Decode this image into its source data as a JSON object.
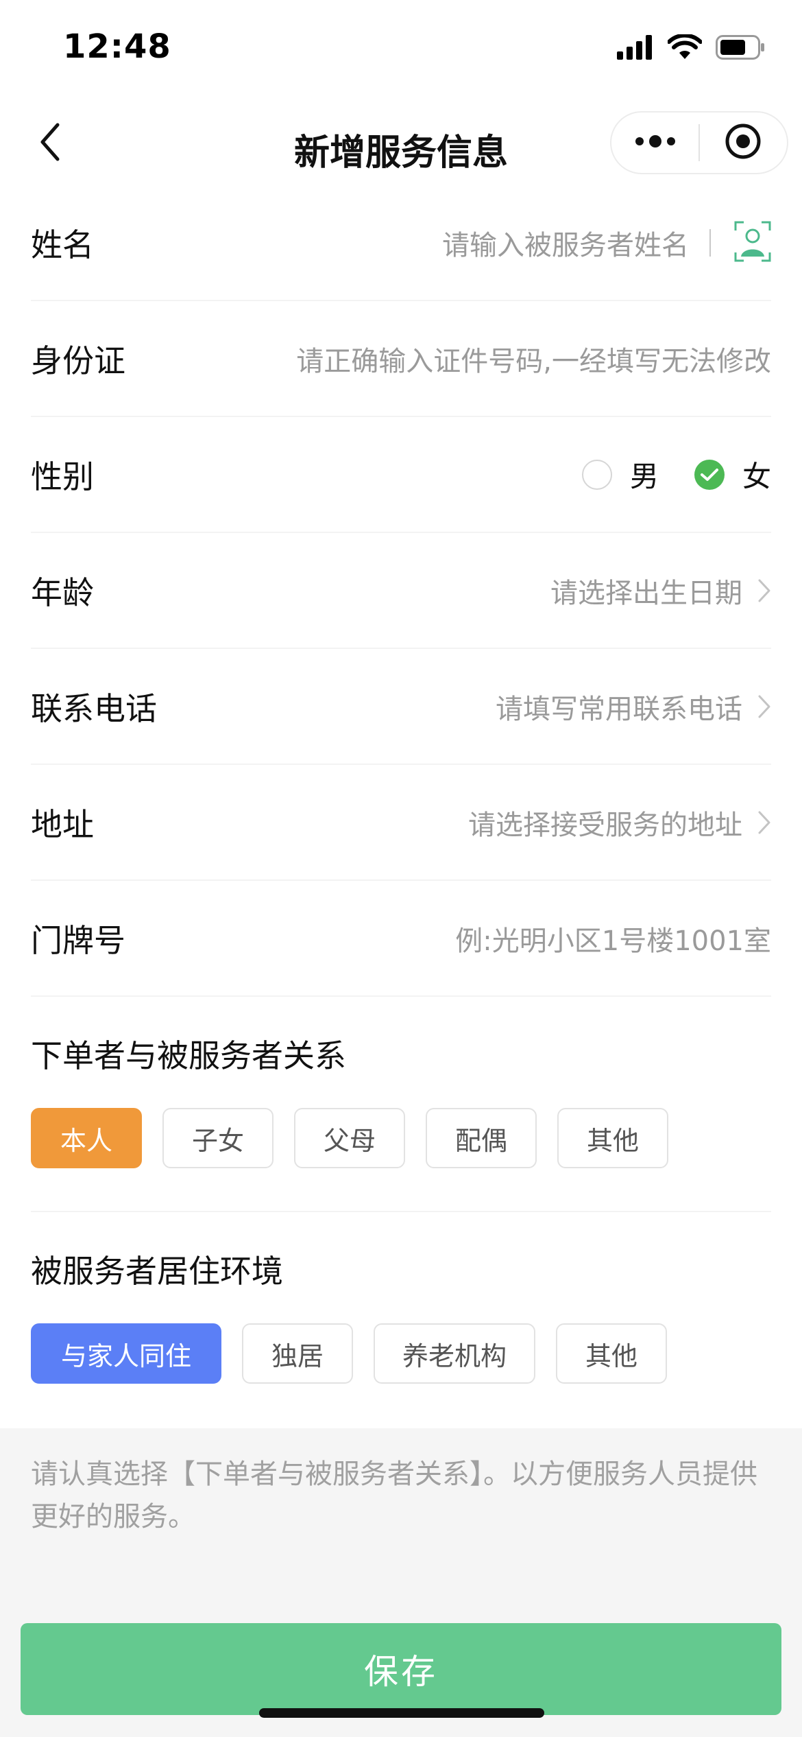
{
  "status_bar": {
    "time": "12:48"
  },
  "nav": {
    "title": "新增服务信息"
  },
  "form": {
    "name": {
      "label": "姓名",
      "placeholder": "请输入被服务者姓名"
    },
    "id_card": {
      "label": "身份证",
      "placeholder": "请正确输入证件号码,一经填写无法修改"
    },
    "gender": {
      "label": "性别",
      "options": [
        "男",
        "女"
      ],
      "selected": "女"
    },
    "age": {
      "label": "年龄",
      "placeholder": "请选择出生日期"
    },
    "phone": {
      "label": "联系电话",
      "placeholder": "请填写常用联系电话"
    },
    "address": {
      "label": "地址",
      "placeholder": "请选择接受服务的地址"
    },
    "house_number": {
      "label": "门牌号",
      "placeholder": "例:光明小区1号楼1001室"
    }
  },
  "relationship": {
    "title": "下单者与被服务者关系",
    "options": [
      "本人",
      "子女",
      "父母",
      "配偶",
      "其他"
    ],
    "selected": "本人"
  },
  "living": {
    "title": "被服务者居住环境",
    "options": [
      "与家人同住",
      "独居",
      "养老机构",
      "其他"
    ],
    "selected": "与家人同住"
  },
  "tip": {
    "text": "请认真选择【下单者与被服务者关系】。以方便服务人员提供更好的服务。"
  },
  "save_label": "保存",
  "colors": {
    "relationship_selected": "#f0993a",
    "living_selected": "#5b7ff6",
    "radio_checked": "#4cb954",
    "save_button": "#64c98f"
  }
}
